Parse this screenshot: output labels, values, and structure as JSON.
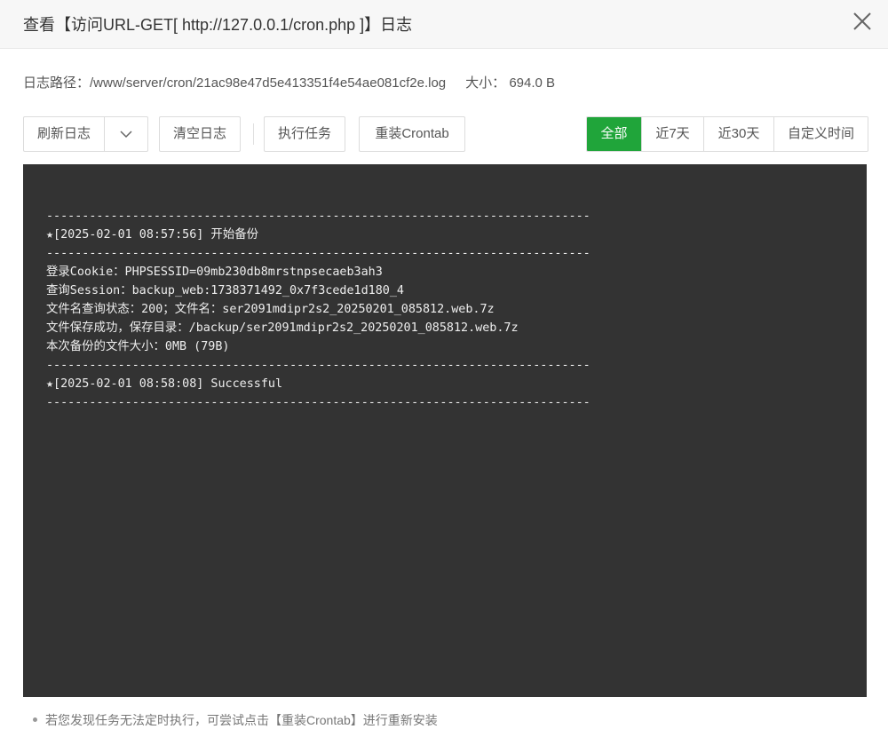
{
  "dialog": {
    "title": "查看【访问URL-GET[ http://127.0.0.1/cron.php ]】日志",
    "close_icon": "close-icon"
  },
  "info": {
    "path_label": "日志路径：",
    "path_value": "/www/server/cron/21ac98e47d5e413351f4e54ae081cf2e.log",
    "size_label": "大小：",
    "size_value": "694.0 B"
  },
  "toolbar": {
    "refresh_label": "刷新日志",
    "dropdown_icon": "chevron-down-icon",
    "clear_label": "清空日志",
    "run_label": "执行任务",
    "reinstall_label": "重装Crontab"
  },
  "filter": {
    "all": "全部",
    "last7": "近7天",
    "last30": "近30天",
    "custom": "自定义时间",
    "active_color": "#20a53a"
  },
  "log": {
    "lines": [
      "----------------------------------------------------------------------------",
      "★[2025-02-01 08:57:56] 开始备份",
      "----------------------------------------------------------------------------",
      "登录Cookie：PHPSESSID=09mb230db8mrstnpsecaeb3ah3",
      "查询Session：backup_web:1738371492_0x7f3cede1d180_4",
      "文件名查询状态：200；文件名：ser2091mdipr2s2_20250201_085812.web.7z",
      "文件保存成功，保存目录：/backup/ser2091mdipr2s2_20250201_085812.web.7z",
      "本次备份的文件大小：0MB (79B)",
      "----------------------------------------------------------------------------",
      "★[2025-02-01 08:58:08] Successful",
      "----------------------------------------------------------------------------"
    ]
  },
  "tip": {
    "text": "若您发现任务无法定时执行，可尝试点击【重装Crontab】进行重新安装"
  }
}
